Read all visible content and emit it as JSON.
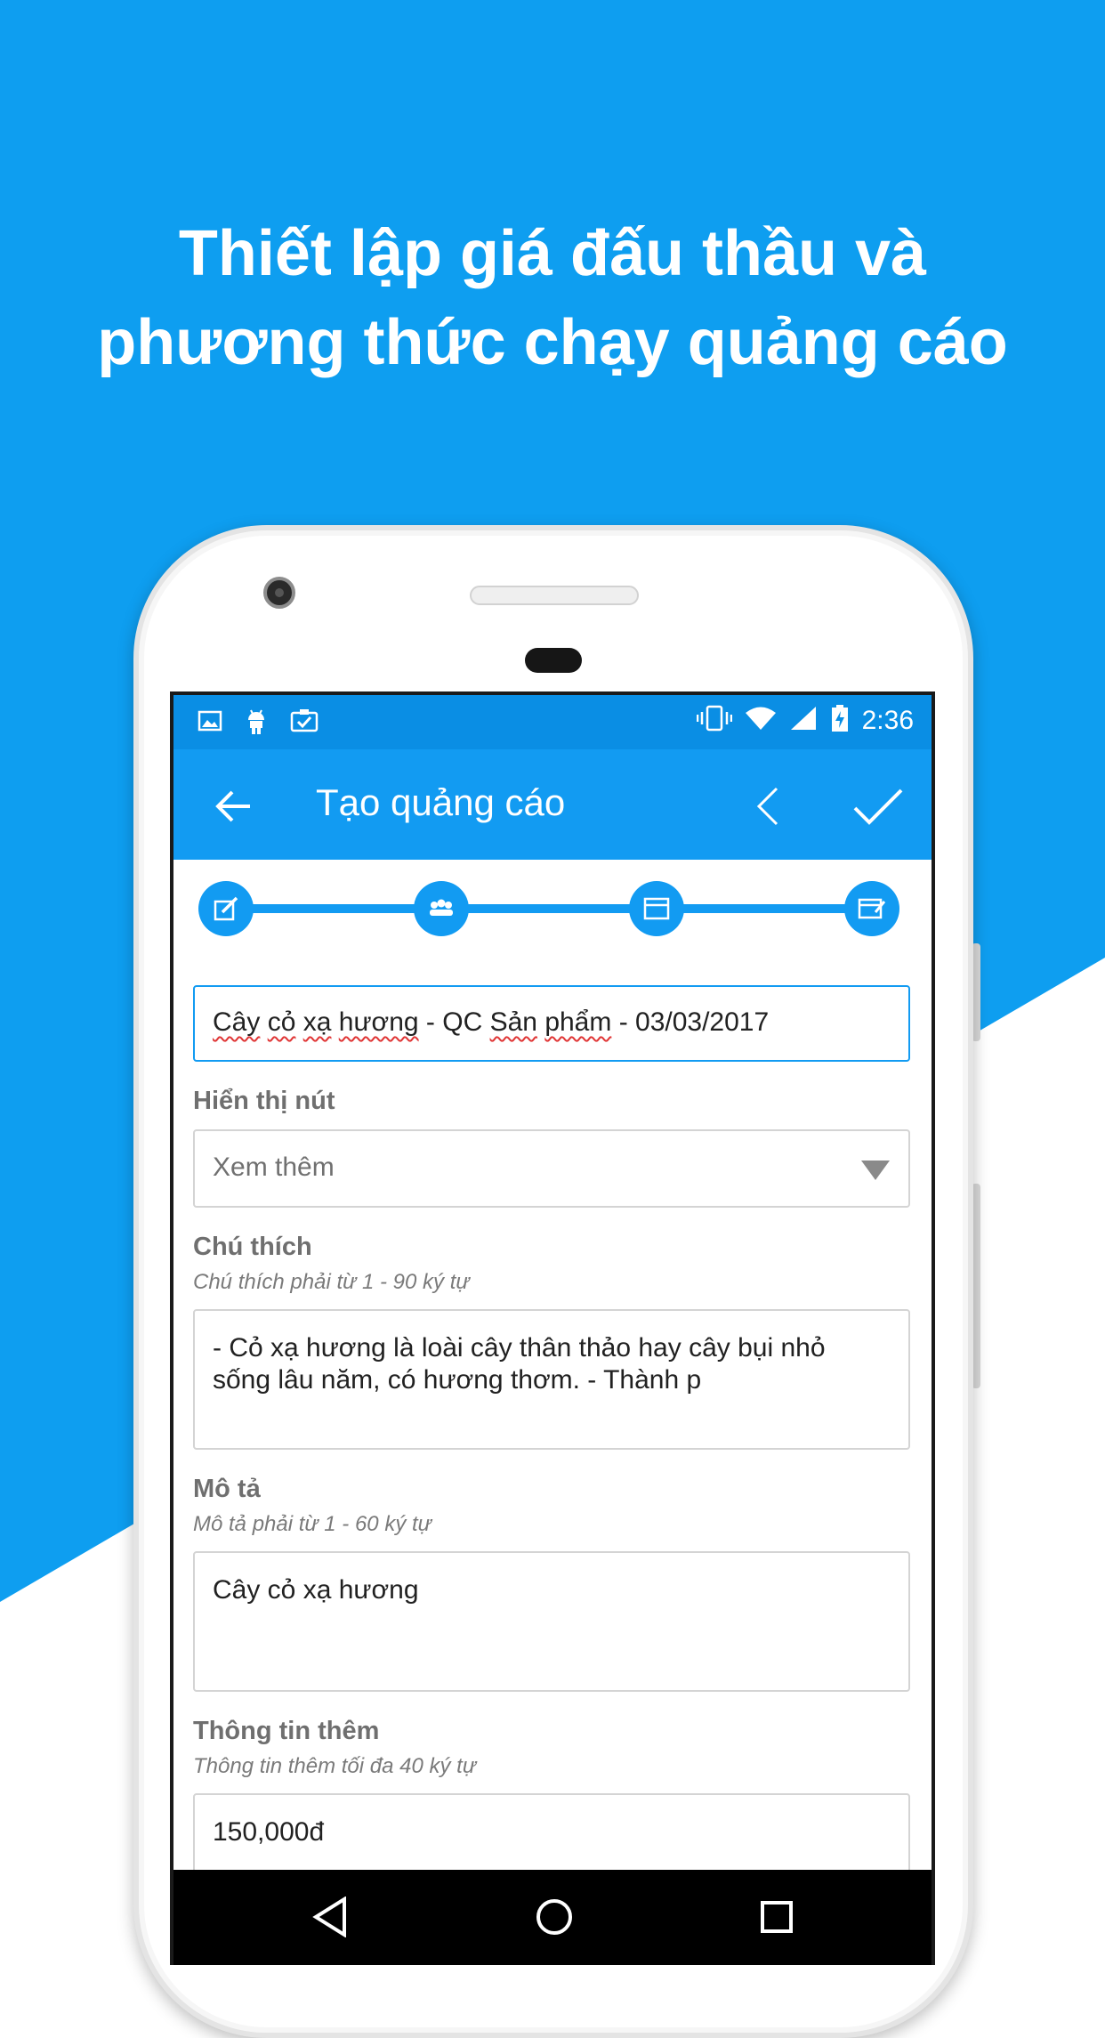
{
  "headline": {
    "line1": "Thiết lập giá đấu thầu và",
    "line2": "phương thức chạy quảng cáo"
  },
  "colors": {
    "background_blue": "#0e9ef0",
    "toolbar_blue": "#129bf2",
    "statusbar_blue": "#0a8ee4",
    "white": "#ffffff"
  },
  "statusbar": {
    "left_icons": [
      "image-icon",
      "android-icon",
      "clipboard-check-icon"
    ],
    "right_icons": [
      "vibrate-icon",
      "wifi-icon",
      "signal-icon",
      "battery-charging-icon"
    ],
    "time": "2:36"
  },
  "toolbar": {
    "back_icon": "arrow-left-icon",
    "title": "Tạo quảng cáo",
    "prev_icon": "chevron-left-icon",
    "confirm_icon": "check-icon"
  },
  "stepper": {
    "steps": [
      "edit-icon",
      "audience-icon",
      "browser-icon",
      "browser-edit-icon"
    ]
  },
  "form": {
    "name": {
      "parts": [
        "Cây",
        " ",
        "cỏ",
        " ",
        "xạ",
        " ",
        "hương",
        " - QC ",
        "Sản",
        " ",
        "phẩm",
        " - 03/03/2017"
      ]
    },
    "button_field": {
      "label": "Hiển thị nút",
      "selected": "Xem thêm"
    },
    "caption": {
      "label": "Chú thích",
      "hint": "Chú thích phải từ 1 - 90 ký tự",
      "line1": "- Cỏ xạ hương là loài cây thân thảo hay cây bụi nhỏ",
      "line2": "sống lâu năm, có hương thơm. - Thành p"
    },
    "description": {
      "label": "Mô tả",
      "hint": "Mô tả phải từ 1 - 60 ký tự",
      "value": "Cây cỏ xạ hương"
    },
    "extra_info": {
      "label": "Thông tin thêm",
      "hint": "Thông tin thêm tối đa 40 ký tự",
      "value": "150,000đ"
    }
  },
  "navbar": {
    "icons": [
      "back-triangle-icon",
      "home-circle-icon",
      "recents-square-icon"
    ]
  }
}
